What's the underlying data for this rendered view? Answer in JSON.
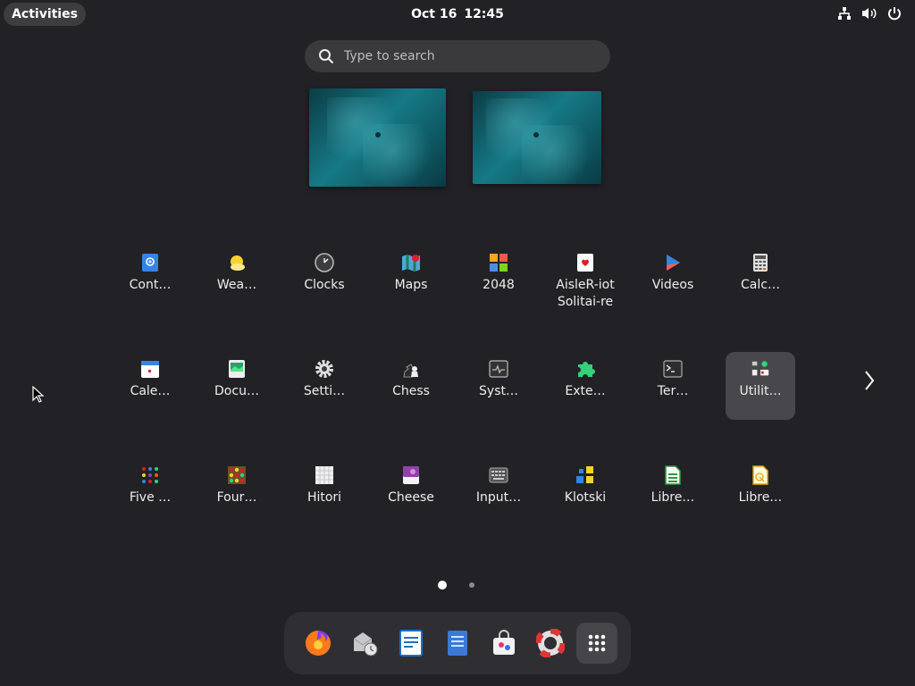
{
  "topbar": {
    "activities_label": "Activities",
    "date": "Oct 16",
    "time": "12:45",
    "tray_icons": [
      "network-icon",
      "volume-icon",
      "power-icon"
    ]
  },
  "search": {
    "placeholder": "Type to search"
  },
  "workspaces": [
    "workspace-1",
    "workspace-2"
  ],
  "apps": [
    {
      "label": "Cont…",
      "icon": "contacts-icon"
    },
    {
      "label": "Wea…",
      "icon": "weather-icon"
    },
    {
      "label": "Clocks",
      "icon": "clocks-icon"
    },
    {
      "label": "Maps",
      "icon": "maps-icon"
    },
    {
      "label": "2048",
      "icon": "game-2048-icon"
    },
    {
      "label": "AisleR-iot Solitai-re",
      "icon": "aisleriot-icon"
    },
    {
      "label": "Videos",
      "icon": "videos-icon"
    },
    {
      "label": "Calc…",
      "icon": "calculator-icon"
    },
    {
      "label": "Cale…",
      "icon": "calendar-icon"
    },
    {
      "label": "Docu…",
      "icon": "document-viewer-icon"
    },
    {
      "label": "Setti…",
      "icon": "settings-icon"
    },
    {
      "label": "Chess",
      "icon": "chess-icon"
    },
    {
      "label": "Syst…",
      "icon": "system-monitor-icon"
    },
    {
      "label": "Exte…",
      "icon": "extensions-icon"
    },
    {
      "label": "Ter…",
      "icon": "terminal-icon"
    },
    {
      "label": "Utilit…",
      "icon": "utilities-folder-icon",
      "selected": true
    },
    {
      "label": "Five …",
      "icon": "five-or-more-icon"
    },
    {
      "label": "Four…",
      "icon": "four-in-a-row-icon"
    },
    {
      "label": "Hitori",
      "icon": "hitori-icon"
    },
    {
      "label": "Cheese",
      "icon": "cheese-icon"
    },
    {
      "label": "Input…",
      "icon": "input-method-icon"
    },
    {
      "label": "Klotski",
      "icon": "klotski-icon"
    },
    {
      "label": "Libre…",
      "icon": "libreoffice-calc-icon"
    },
    {
      "label": "Libre…",
      "icon": "libreoffice-draw-icon"
    }
  ],
  "next_page_icon": "chevron-right-icon",
  "pager": {
    "pages": 2,
    "current": 1
  },
  "dock": [
    {
      "icon": "firefox-icon"
    },
    {
      "icon": "mail-clock-icon"
    },
    {
      "icon": "writer-icon"
    },
    {
      "icon": "text-editor-icon"
    },
    {
      "icon": "software-icon"
    },
    {
      "icon": "help-icon"
    },
    {
      "icon": "show-apps-icon"
    }
  ],
  "colors": {
    "background": "#222226",
    "panel": "#3d3d40",
    "selected": "#48484c"
  }
}
